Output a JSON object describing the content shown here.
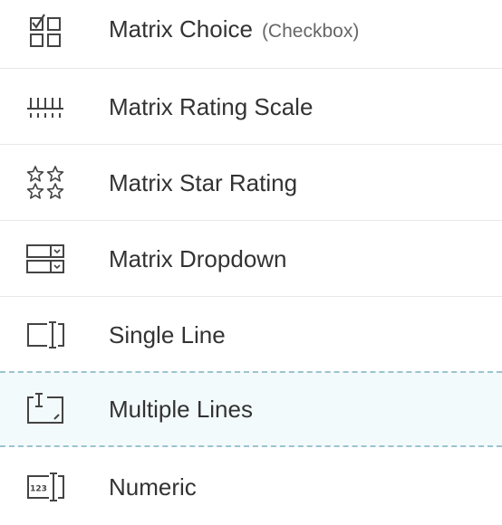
{
  "items": [
    {
      "label": "Matrix Choice",
      "sub": "(Checkbox)",
      "icon": "matrix-choice-icon"
    },
    {
      "label": "Matrix Rating Scale",
      "icon": "rating-scale-icon"
    },
    {
      "label": "Matrix Star Rating",
      "icon": "star-rating-icon"
    },
    {
      "label": "Matrix Dropdown",
      "icon": "dropdown-icon"
    },
    {
      "label": "Single Line",
      "icon": "single-line-icon"
    },
    {
      "label": "Multiple Lines",
      "icon": "multiple-lines-icon",
      "selected": true
    },
    {
      "label": "Numeric",
      "icon": "numeric-icon"
    }
  ],
  "colors": {
    "text": "#333333",
    "subtext": "#666666",
    "divider": "#e8e8e8",
    "selected_bg": "#f3fafb",
    "selected_border": "#9cc3cf"
  }
}
